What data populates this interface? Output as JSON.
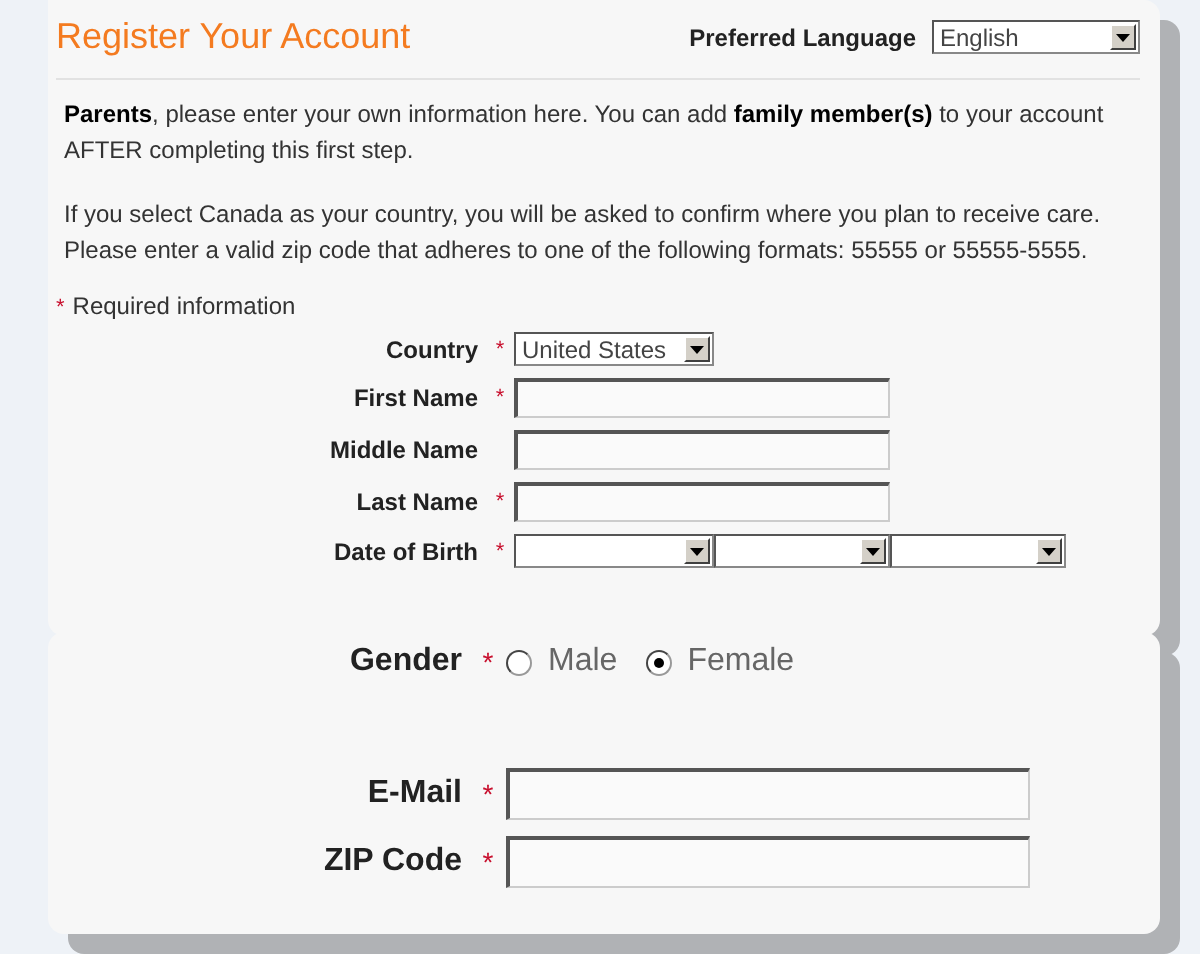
{
  "title": "Register Your Account",
  "language": {
    "label": "Preferred Language",
    "value": "English"
  },
  "intro": [
    "**Parents**, please enter your own information here. You can add **family member(s)** to your account AFTER completing this first step.",
    "If you select Canada as your country, you will be asked to confirm where you plan to receive care. Please enter a valid zip code that adheres to one of the following formats: 55555 or 55555-5555."
  ],
  "required_note": {
    "mark": "*",
    "text": "Required information"
  },
  "fields": [
    {
      "label": "Country",
      "required": true,
      "kind": "select",
      "value": "United States"
    },
    {
      "label": "First Name",
      "required": true,
      "kind": "text"
    },
    {
      "label": "Middle Name",
      "required": false,
      "kind": "text"
    },
    {
      "label": "Last Name",
      "required": true,
      "kind": "text"
    },
    {
      "label": "Date of Birth",
      "required": true,
      "kind": "date"
    }
  ],
  "zoomed_fields": [
    {
      "label": "Gender",
      "required": true,
      "kind": "radio",
      "options": [
        {
          "label": "Male",
          "selected": false
        },
        {
          "label": "Female",
          "selected": true
        }
      ]
    },
    {
      "label": "E-Mail",
      "required": true,
      "kind": "text"
    },
    {
      "label": "ZIP Code",
      "required": true,
      "kind": "text"
    }
  ]
}
